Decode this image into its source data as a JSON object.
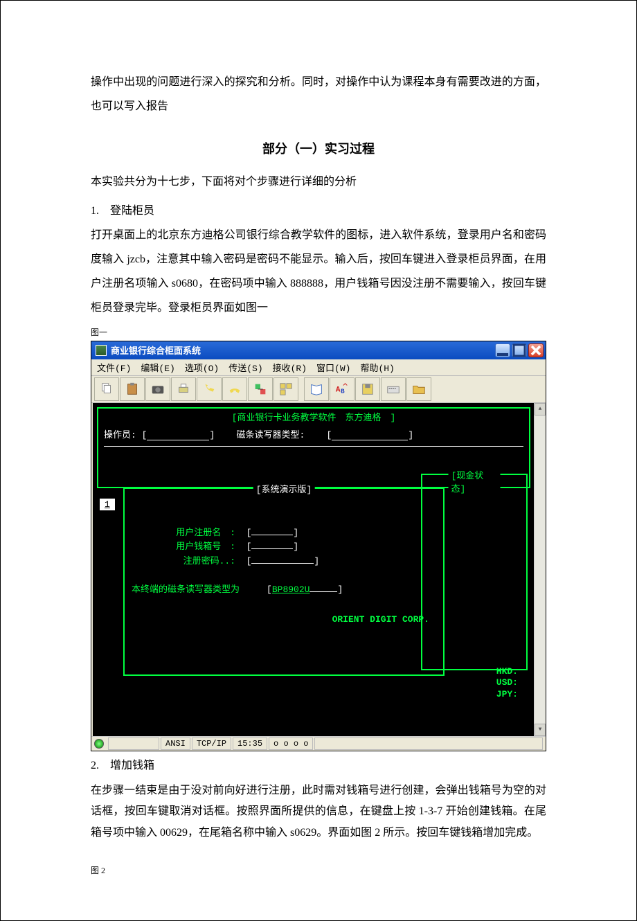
{
  "intro": "操作中出现的问题进行深入的探究和分析。同时，对操作中认为课程本身有需要改进的方面，也可以写入报告",
  "section_title": "部分（一）实习过程",
  "intro2": "本实验共分为十七步，下面将对个步骤进行详细的分析",
  "step1": {
    "num": "1.　登陆柜员",
    "body": "打开桌面上的北京东方迪格公司银行综合教学软件的图标，进入软件系统，登录用户名和密码度输入 jzcb，注意其中输入密码是密码不能显示。输入后，按回车键进入登录柜员界面，在用户注册名项输入 s0680，在密码项中输入 888888，用户钱箱号因没注册不需要输入，按回车键柜员登录完毕。登录柜员界面如图一"
  },
  "fig1_label": "图一",
  "window": {
    "title": "商业银行综合柜面系统",
    "menus": [
      "文件(F)",
      "编辑(E)",
      "选项(O)",
      "传送(S)",
      "接收(R)",
      "窗口(W)",
      "帮助(H)"
    ],
    "terminal": {
      "header": "[商业银行卡业务教学软件　东方迪格　]",
      "operator_label": "操作员:",
      "reader_label": "磁条读写器类型:",
      "main_legend": "[系统演示版]",
      "cash_legend": "[现金状态]",
      "page_badge": "1",
      "form": {
        "l1": "用户注册名　:",
        "l2": "用户钱箱号　:",
        "l3": "注册密码..:",
        "termtype_label": "本终端的磁条读写器类型为",
        "termtype_value": "BP8902U"
      },
      "corp": "ORIENT DIGIT CORP.",
      "currencies": [
        "HKD:",
        "USD:",
        "JPY:"
      ]
    },
    "status": {
      "ansi": "ANSI",
      "tcpip": "TCP/IP",
      "time": "15:35",
      "oooo": "o o o o"
    }
  },
  "step2": {
    "num": "2.　增加钱箱",
    "body": "在步骤一结束是由于没对前向好进行注册，此时需对钱箱号进行创建，会弹出钱箱号为空的对话框，按回车键取消对话框。按照界面所提供的信息，在键盘上按 1-3-7 开始创建钱箱。在尾箱号项中输入 00629，在尾箱名称中输入 s0629。界面如图 2 所示。按回车键钱箱增加完成。"
  },
  "fig2_label": "图 2"
}
